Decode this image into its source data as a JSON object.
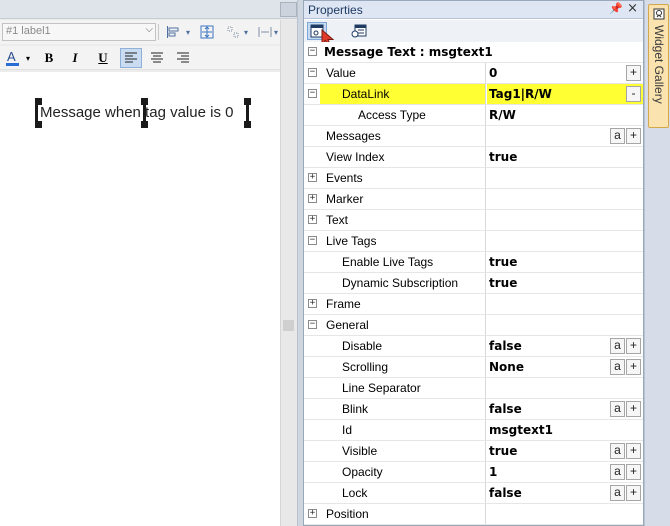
{
  "editor": {
    "label_selector": "#1 label1",
    "message_text": "Message when tag value is 0"
  },
  "properties": {
    "title": "Properties",
    "header": "Message Text : msgtext1",
    "rows": [
      {
        "name": "Value",
        "value": "0",
        "expander": "−",
        "buttons": [
          "+"
        ]
      },
      {
        "name": "DataLink",
        "value": "Tag1|R/W",
        "expander": "−",
        "buttons": [
          "-"
        ]
      },
      {
        "name": "Access Type",
        "value": "R/W"
      },
      {
        "name": "Messages",
        "value": "",
        "buttons": [
          "a",
          "+"
        ]
      },
      {
        "name": "View Index",
        "value": "true"
      },
      {
        "name": "Events",
        "expander": "+"
      },
      {
        "name": "Marker",
        "expander": "+"
      },
      {
        "name": "Text",
        "expander": "+"
      },
      {
        "name": "Live Tags",
        "expander": "−"
      },
      {
        "name": "Enable Live Tags",
        "value": "true"
      },
      {
        "name": "Dynamic Subscription",
        "value": "true"
      },
      {
        "name": "Frame",
        "expander": "+"
      },
      {
        "name": "General",
        "expander": "−"
      },
      {
        "name": "Disable",
        "value": "false",
        "buttons": [
          "a",
          "+"
        ]
      },
      {
        "name": "Scrolling",
        "value": "None",
        "buttons": [
          "a",
          "+"
        ]
      },
      {
        "name": "Line Separator",
        "value": ""
      },
      {
        "name": "Blink",
        "value": "false",
        "buttons": [
          "a",
          "+"
        ]
      },
      {
        "name": "Id",
        "value": "msgtext1"
      },
      {
        "name": "Visible",
        "value": "true",
        "buttons": [
          "a",
          "+"
        ]
      },
      {
        "name": "Opacity",
        "value": "1",
        "buttons": [
          "a",
          "+"
        ]
      },
      {
        "name": "Lock",
        "value": "false",
        "buttons": [
          "a",
          "+"
        ]
      },
      {
        "name": "Position",
        "expander": "+"
      }
    ]
  },
  "gallery": {
    "label": "Widget Gallery"
  },
  "colors": {
    "highlight": "#ffff33",
    "accent": "#1f3a63"
  }
}
